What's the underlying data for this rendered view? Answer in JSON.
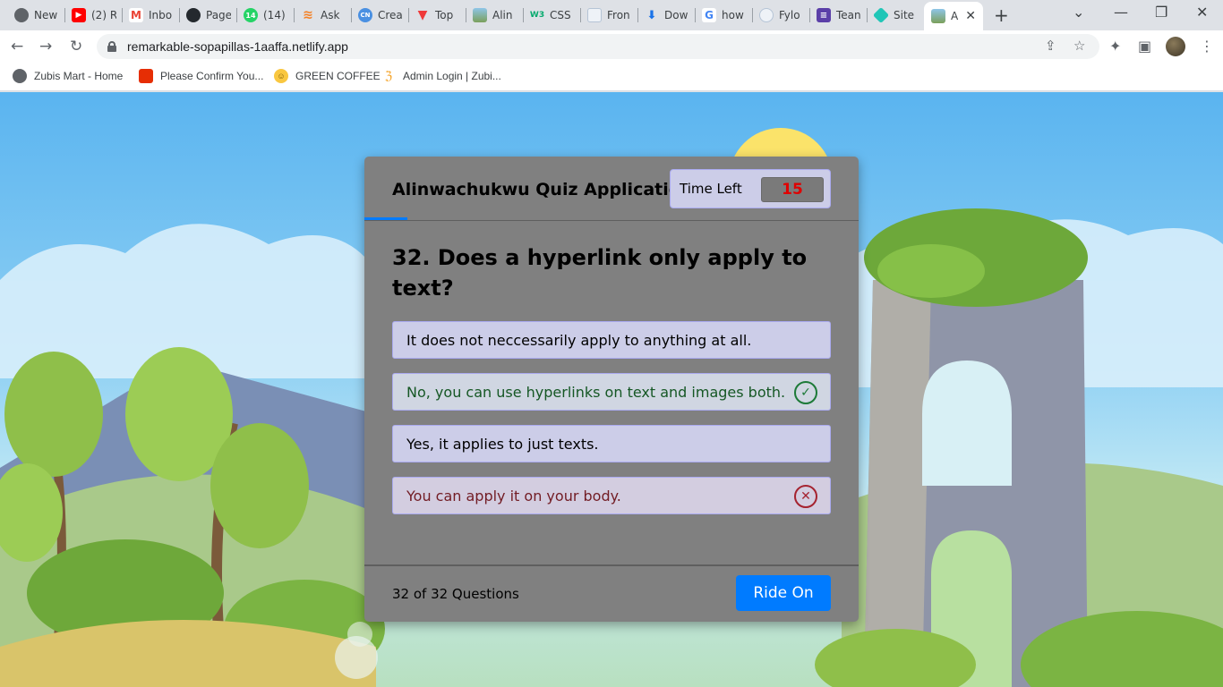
{
  "browser": {
    "tabs": [
      {
        "label": "New",
        "icon": "chrome-icon",
        "color": "#5f6368"
      },
      {
        "label": "(2) R",
        "icon": "youtube-icon",
        "color": "#ff0000"
      },
      {
        "label": "Inbo",
        "icon": "gmail-icon",
        "color": "#ea4335"
      },
      {
        "label": "Page",
        "icon": "github-icon",
        "color": "#24292e"
      },
      {
        "label": "(14)",
        "icon": "whatsapp-icon",
        "color": "#25d366",
        "badge": "14"
      },
      {
        "label": "Ask",
        "icon": "stackoverflow-icon",
        "color": "#f48024"
      },
      {
        "label": "Crea",
        "icon": "codenewbie-icon",
        "color": "#4a90e2",
        "badge": "CN"
      },
      {
        "label": "Top",
        "icon": "vivaldi-icon",
        "color": "#ef3939"
      },
      {
        "label": "Alin",
        "icon": "site-image-icon",
        "color": "#7ba05b"
      },
      {
        "label": "CSS",
        "icon": "w3schools-icon",
        "color": "#04aa6d",
        "badge": "W3"
      },
      {
        "label": "Fron",
        "icon": "frontend-icon",
        "color": "#b5c4d6"
      },
      {
        "label": "Dow",
        "icon": "download-icon",
        "color": "#1a73e8"
      },
      {
        "label": "how",
        "icon": "google-icon",
        "color": "#4285f4"
      },
      {
        "label": "Fylo",
        "icon": "fylo-icon",
        "color": "#b5c4d6"
      },
      {
        "label": "Tean",
        "icon": "teams-icon",
        "color": "#5b3fa8"
      },
      {
        "label": "Site",
        "icon": "netlify-icon",
        "color": "#20c6b7"
      }
    ],
    "active_tab": {
      "label": "A",
      "icon": "site-image-icon"
    },
    "address": "remarkable-sopapillas-1aaffa.netlify.app",
    "bookmarks": [
      {
        "label": "Zubis Mart - Home",
        "icon": "globe-icon",
        "color": "#5f6368"
      },
      {
        "label": "Please Confirm You...",
        "icon": "aliexpress-icon",
        "color": "#e62e04"
      },
      {
        "label": "GREEN COFFEE",
        "icon": "smiley-icon",
        "color": "#f9c740"
      },
      {
        "label": "Admin Login | Zubi...",
        "icon": "swirl-icon",
        "color": "#f4a020"
      }
    ]
  },
  "quiz": {
    "title": "Alinwachukwu Quiz Application",
    "timer_label": "Time Left",
    "timer_value": "15",
    "question": "32. Does a hyperlink only apply to text?",
    "options": [
      {
        "text": "It does not neccessarily apply to anything at all.",
        "state": "neutral"
      },
      {
        "text": "No, you can use hyperlinks on text and images both.",
        "state": "correct"
      },
      {
        "text": "Yes, it applies to just texts.",
        "state": "neutral"
      },
      {
        "text": "You can apply it on your body.",
        "state": "incorrect"
      }
    ],
    "progress": "32 of 32 Questions",
    "next_label": "Ride On",
    "colors": {
      "accent": "#007bff",
      "card": "#808080",
      "option_bg": "#cccde8",
      "correct": "#155724",
      "incorrect": "#721c24",
      "timer_text": "#e00000"
    }
  }
}
